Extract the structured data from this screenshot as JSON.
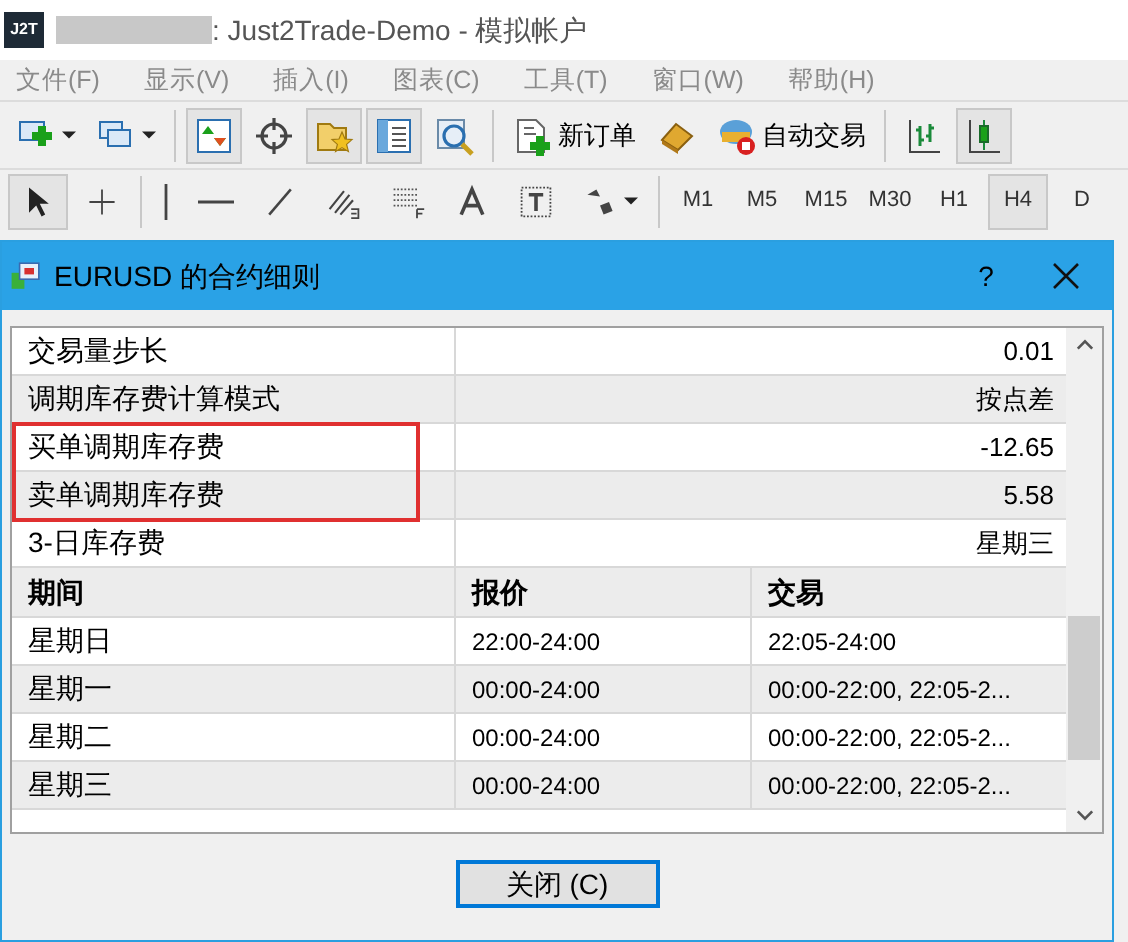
{
  "window": {
    "title": ": Just2Trade-Demo - 模拟帐户",
    "logo": "J2T"
  },
  "menu": [
    "文件(F)",
    "显示(V)",
    "插入(I)",
    "图表(C)",
    "工具(T)",
    "窗口(W)",
    "帮助(H)"
  ],
  "toolbar": [
    {
      "kind": "icon",
      "pressed": false
    },
    {
      "kind": "icon",
      "pressed": false
    },
    {
      "kind": "icon",
      "pressed": true
    },
    {
      "kind": "icon",
      "pressed": false
    },
    {
      "kind": "icon",
      "pressed": true
    },
    {
      "kind": "icon",
      "pressed": true
    },
    {
      "kind": "icon",
      "pressed": false
    },
    {
      "kind": "labeled",
      "label": "新订单",
      "pressed": false
    },
    {
      "kind": "icon",
      "pressed": false
    },
    {
      "kind": "labeled",
      "label": "自动交易",
      "pressed": false
    },
    {
      "kind": "icon",
      "pressed": false
    },
    {
      "kind": "icon",
      "pressed": true
    }
  ],
  "drawing_tools": [
    {
      "pressed": true
    },
    {
      "pressed": false
    },
    {
      "pressed": false
    },
    {
      "pressed": false
    },
    {
      "pressed": false
    },
    {
      "pressed": false
    },
    {
      "pressed": false
    },
    {
      "pressed": false
    },
    {
      "pressed": false
    },
    {
      "pressed": false
    }
  ],
  "timeframes": [
    {
      "label": "M1",
      "selected": false
    },
    {
      "label": "M5",
      "selected": false
    },
    {
      "label": "M15",
      "selected": false
    },
    {
      "label": "M30",
      "selected": false
    },
    {
      "label": "H1",
      "selected": false
    },
    {
      "label": "H4",
      "selected": true
    },
    {
      "label": "D",
      "selected": false
    }
  ],
  "dialog": {
    "title": "EURUSD 的合约细则",
    "help": "?",
    "properties": [
      {
        "name": "交易量步长",
        "value": "0.01",
        "highlighted": false
      },
      {
        "name": "调期库存费计算模式",
        "value": "按点差",
        "highlighted": false
      },
      {
        "name": "买单调期库存费",
        "value": "-12.65",
        "highlighted": true
      },
      {
        "name": "卖单调期库存费",
        "value": "5.58",
        "highlighted": true
      },
      {
        "name": "3-日库存费",
        "value": "星期三",
        "highlighted": false
      }
    ],
    "sessions": {
      "columns": [
        "期间",
        "报价",
        "交易"
      ],
      "rows": [
        [
          "星期日",
          "22:00-24:00",
          "22:05-24:00"
        ],
        [
          "星期一",
          "00:00-24:00",
          "00:00-22:00, 22:05-2..."
        ],
        [
          "星期二",
          "00:00-24:00",
          "00:00-22:00, 22:05-2..."
        ],
        [
          "星期三",
          "00:00-24:00",
          "00:00-22:00, 22:05-2..."
        ]
      ]
    },
    "button": "关闭 (C)"
  }
}
